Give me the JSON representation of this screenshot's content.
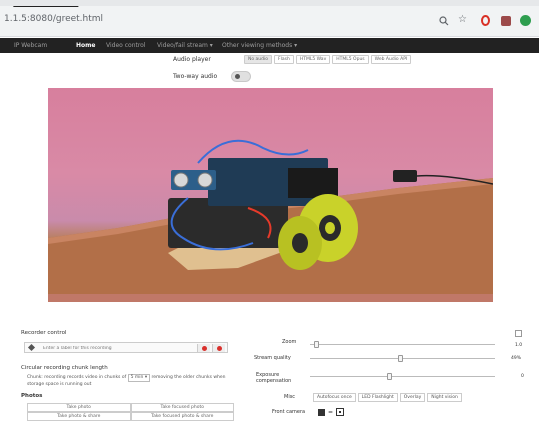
{
  "browser": {
    "url": "1.1.5:8080/greet.html"
  },
  "navbar": {
    "brand": "IP Webcam",
    "items": [
      "Home",
      "Video control",
      "Video/fail stream ▾",
      "Other viewing methods ▾"
    ]
  },
  "audio": {
    "player_label": "Audio player",
    "buttons": [
      "No audio",
      "Flash",
      "HTML5 Wav",
      "HTML5 Opus",
      "Web Audio API"
    ],
    "twoway_label": "Two-way audio"
  },
  "video": {
    "feed_colors": {
      "wall": "#d98aa6",
      "desk": "#b06d45",
      "wheel": "#c9d22a"
    }
  },
  "recorder": {
    "title": "Recorder control",
    "input_placeholder": "Enter a label for this recording"
  },
  "chunk": {
    "title": "Circular recording chunk length",
    "text_prefix": "Chunk: recording records video in chunks of",
    "select_value": "5 min ▾",
    "text_suffix": "removing the older chunks when storage space is running out"
  },
  "photos": {
    "title": "Photos",
    "cells": [
      "Take photo",
      "Take focused photo",
      "Take photo & share",
      "Take focused photo & share"
    ]
  },
  "controls": {
    "zoom_label": "Zoom",
    "zoom_value": "1.0",
    "zoom_level": 0.04,
    "quality_label": "Stream quality",
    "quality_value": "49%",
    "quality_level": 0.49,
    "exposure_label_1": "Exposure",
    "exposure_label_2": "compensation",
    "exposure_value": "0",
    "exposure_level": 0.43,
    "misc_label": "Misc",
    "misc_buttons": [
      "Autofocus once",
      "LED Flashlight",
      "Overlay",
      "Night vision"
    ],
    "front_label": "Front camera"
  }
}
